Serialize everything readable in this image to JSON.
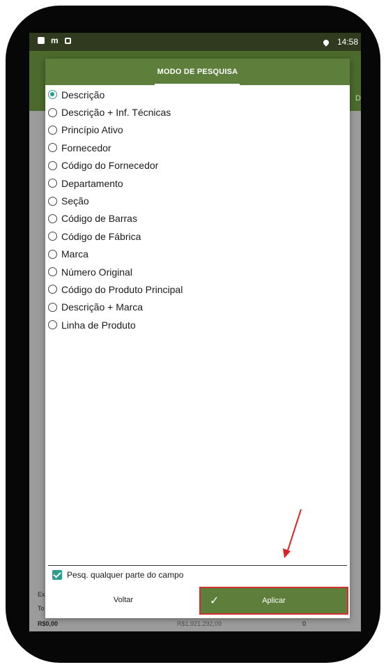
{
  "status_bar": {
    "time": "14:58",
    "icons": [
      "android-icon",
      "m-icon",
      "image-icon",
      "location-icon"
    ]
  },
  "background": {
    "hint_text": "D",
    "bottom_left_values": [
      "Ex",
      "To",
      "R$0,00"
    ],
    "bottom_center_value": "R$1.921.292,09",
    "bottom_right_value": "0"
  },
  "dialog": {
    "title": "MODO DE PESQUISA",
    "options": [
      {
        "label": "Descrição",
        "selected": true
      },
      {
        "label": "Descrição + Inf. Técnicas",
        "selected": false
      },
      {
        "label": "Princípio Ativo",
        "selected": false
      },
      {
        "label": "Fornecedor",
        "selected": false
      },
      {
        "label": "Código do Fornecedor",
        "selected": false
      },
      {
        "label": "Departamento",
        "selected": false
      },
      {
        "label": "Seção",
        "selected": false
      },
      {
        "label": "Código de Barras",
        "selected": false
      },
      {
        "label": "Código de Fábrica",
        "selected": false
      },
      {
        "label": "Marca",
        "selected": false
      },
      {
        "label": "Número Original",
        "selected": false
      },
      {
        "label": "Código do Produto Principal",
        "selected": false
      },
      {
        "label": "Descrição + Marca",
        "selected": false
      },
      {
        "label": "Linha de Produto",
        "selected": false
      }
    ],
    "partial_search": {
      "label": "Pesq. qualquer parte do campo",
      "checked": true
    },
    "buttons": {
      "back": "Voltar",
      "apply": "Aplicar"
    }
  },
  "colors": {
    "header_green": "#5d7f3b",
    "appbar_green": "#4b6a2c",
    "accent_teal": "#2a9d8f",
    "highlight_red": "#d32f2f"
  }
}
